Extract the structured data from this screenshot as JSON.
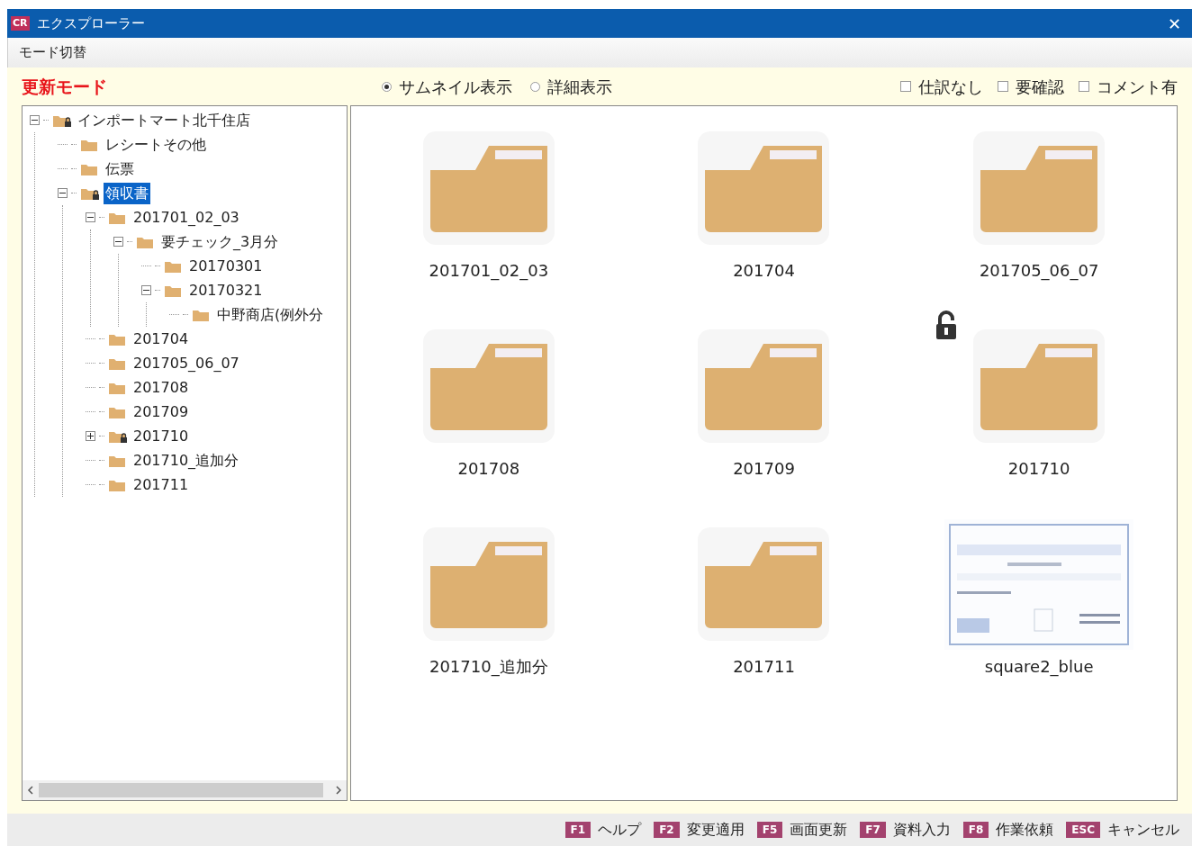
{
  "window": {
    "app_badge": "CR",
    "title": "エクスプローラー",
    "close": "✕"
  },
  "menu": [
    "モード切替"
  ],
  "mode_label": "更新モード",
  "view_options": [
    {
      "label": "サムネイル表示",
      "selected": true
    },
    {
      "label": "詳細表示",
      "selected": false
    }
  ],
  "filters": [
    {
      "label": "仕訳なし",
      "checked": false
    },
    {
      "label": "要確認",
      "checked": false
    },
    {
      "label": "コメント有",
      "checked": false
    }
  ],
  "tree": [
    {
      "label": "インポートマート北千住店",
      "locked": true,
      "selected": false,
      "expanded": true,
      "children": [
        {
          "label": "レシートその他",
          "locked": false,
          "selected": false
        },
        {
          "label": "伝票",
          "locked": false,
          "selected": false
        },
        {
          "label": "領収書",
          "locked": true,
          "selected": true,
          "expanded": true,
          "children": [
            {
              "label": "201701_02_03",
              "locked": false,
              "selected": false,
              "expanded": true,
              "children": [
                {
                  "label": "要チェック_3月分",
                  "locked": false,
                  "selected": false,
                  "expanded": true,
                  "children": [
                    {
                      "label": "20170301",
                      "locked": false,
                      "selected": false
                    },
                    {
                      "label": "20170321",
                      "locked": false,
                      "selected": false,
                      "expanded": true,
                      "children": [
                        {
                          "label": "中野商店(例外分",
                          "locked": false,
                          "selected": false
                        }
                      ]
                    }
                  ]
                }
              ]
            },
            {
              "label": "201704",
              "locked": false,
              "selected": false
            },
            {
              "label": "201705_06_07",
              "locked": false,
              "selected": false
            },
            {
              "label": "201708",
              "locked": false,
              "selected": false
            },
            {
              "label": "201709",
              "locked": false,
              "selected": false
            },
            {
              "label": "201710",
              "locked": true,
              "selected": false,
              "expanded": false
            },
            {
              "label": "201710_追加分",
              "locked": false,
              "selected": false
            },
            {
              "label": "201711",
              "locked": false,
              "selected": false
            }
          ]
        }
      ]
    }
  ],
  "items": [
    {
      "kind": "folder",
      "label": "201701_02_03",
      "locked": false
    },
    {
      "kind": "folder",
      "label": "201704",
      "locked": false
    },
    {
      "kind": "folder",
      "label": "201705_06_07",
      "locked": false
    },
    {
      "kind": "folder",
      "label": "201708",
      "locked": false
    },
    {
      "kind": "folder",
      "label": "201709",
      "locked": false
    },
    {
      "kind": "folder",
      "label": "201710",
      "locked": true
    },
    {
      "kind": "folder",
      "label": "201710_追加分",
      "locked": false
    },
    {
      "kind": "folder",
      "label": "201711",
      "locked": false
    },
    {
      "kind": "picture",
      "label": "square2_blue",
      "locked": false
    }
  ],
  "function_keys": [
    {
      "key": "F1",
      "label": "ヘルプ"
    },
    {
      "key": "F2",
      "label": "変更適用"
    },
    {
      "key": "F5",
      "label": "画面更新"
    },
    {
      "key": "F7",
      "label": "資料入力"
    },
    {
      "key": "F8",
      "label": "作業依頼"
    },
    {
      "key": "ESC",
      "label": "キャンセル"
    }
  ]
}
